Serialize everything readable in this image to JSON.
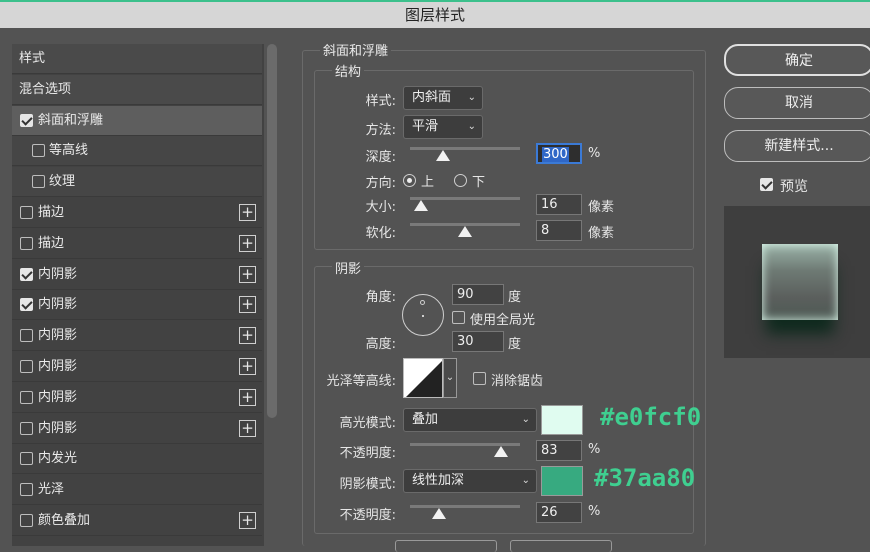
{
  "window": {
    "title": "图层样式"
  },
  "left_list": {
    "items": [
      {
        "label": "样式",
        "type": "header"
      },
      {
        "label": "混合选项",
        "type": "header"
      },
      {
        "label": "斜面和浮雕",
        "checked": true,
        "selected": true
      },
      {
        "label": "等高线",
        "checked": false,
        "sub": true
      },
      {
        "label": "纹理",
        "checked": false,
        "sub": true
      },
      {
        "label": "描边",
        "checked": false,
        "plus": "+"
      },
      {
        "label": "描边",
        "checked": false,
        "plus": "+"
      },
      {
        "label": "内阴影",
        "checked": true,
        "plus": "+"
      },
      {
        "label": "内阴影",
        "checked": true,
        "plus": "+"
      },
      {
        "label": "内阴影",
        "checked": false,
        "plus": "+"
      },
      {
        "label": "内阴影",
        "checked": false,
        "plus": "+"
      },
      {
        "label": "内阴影",
        "checked": false,
        "plus": "+"
      },
      {
        "label": "内阴影",
        "checked": false,
        "plus": "+"
      },
      {
        "label": "内发光",
        "checked": false
      },
      {
        "label": "光泽",
        "checked": false
      },
      {
        "label": "颜色叠加",
        "checked": false,
        "plus": "+"
      }
    ]
  },
  "bevel": {
    "group_title": "斜面和浮雕",
    "structure_title": "结构",
    "style_label": "样式:",
    "style_value": "内斜面",
    "technique_label": "方法:",
    "technique_value": "平滑",
    "depth_label": "深度:",
    "depth_value": "300",
    "depth_unit": "%",
    "direction_label": "方向:",
    "direction_up": "上",
    "direction_down": "下",
    "size_label": "大小:",
    "size_value": "16",
    "size_unit": "像素",
    "soften_label": "软化:",
    "soften_value": "8",
    "soften_unit": "像素",
    "depth_slider_fraction": 0.3,
    "size_slider_fraction": 0.1,
    "soften_slider_fraction": 0.5
  },
  "shading": {
    "title": "阴影",
    "angle_label": "角度:",
    "angle_value": "90",
    "angle_unit": "度",
    "global_light_label": "使用全局光",
    "altitude_label": "高度:",
    "altitude_value": "30",
    "altitude_unit": "度",
    "gloss_label": "光泽等高线:",
    "antialias_label": "消除锯齿",
    "highlight_label": "高光模式:",
    "highlight_mode": "叠加",
    "highlight_color": "#e0fcf0",
    "highlight_annotation": "#e0fcf0",
    "opacity1_label": "不透明度:",
    "opacity1_value": "83",
    "opacity1_unit": "%",
    "shadow_label": "阴影模式:",
    "shadow_mode": "线性加深",
    "shadow_color": "#37aa80",
    "shadow_annotation": "#37aa80",
    "opacity2_label": "不透明度:",
    "opacity2_value": "26",
    "opacity2_unit": "%",
    "opacity1_slider_fraction": 0.83,
    "opacity2_slider_fraction": 0.26
  },
  "buttons": {
    "ok": "确定",
    "cancel": "取消",
    "new_style": "新建样式...",
    "preview_label": "预览"
  }
}
